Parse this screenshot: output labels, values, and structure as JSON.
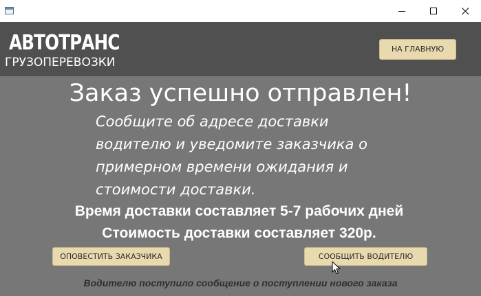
{
  "window": {
    "icon": "app-window-icon",
    "controls": [
      "minimize-icon",
      "maximize-icon",
      "close-icon"
    ]
  },
  "header": {
    "logo_main": "АВТОТРАНС",
    "logo_sub": "ГРУЗОПЕРЕВОЗКИ",
    "home_button": "НА ГЛАВНУЮ"
  },
  "content": {
    "heading": "Заказ успешно отправлен!",
    "message": "Сообщите об адресе доставки водителю и уведомите заказчика о примерном времени ожидания и стоимости доставки.",
    "delivery_time": "Время доставки составляет 5-7 рабочих дней",
    "delivery_cost": "Стоимость доставки составляет 320р.",
    "notify_customer_button": "ОПОВЕСТИТЬ ЗАКАЗЧИКА",
    "notify_driver_button": "СООБЩИТЬ ВОДИТЕЛЮ",
    "status_message": "Водителю поступило сообщение о поступлении нового заказа"
  },
  "colors": {
    "header_bg": "#505050",
    "content_bg": "#777777",
    "button_bg": "#e8d9ae",
    "text_light": "#ffffff",
    "status_text": "#2f2f2f"
  }
}
